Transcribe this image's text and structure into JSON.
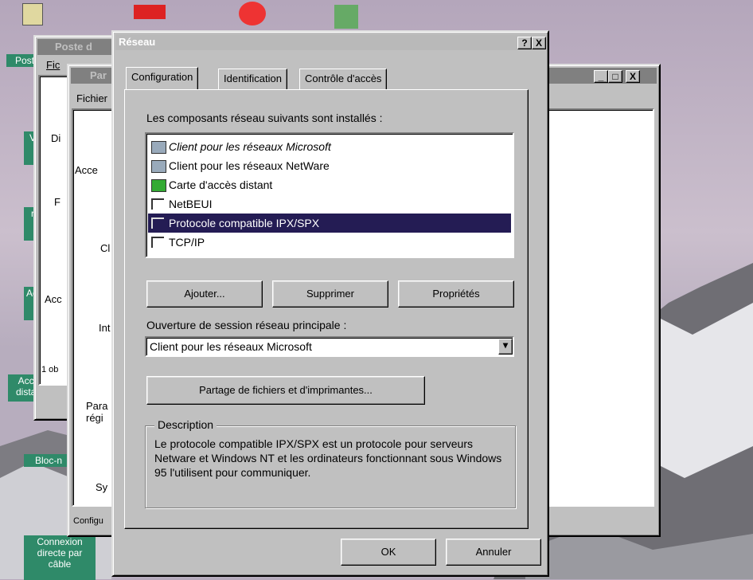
{
  "colors": {
    "desktop_label_bg": "#2f8a69",
    "selected_row": "#241c54",
    "face": "#c0c0c0"
  },
  "desktop": {
    "labels": [
      "Post",
      "V",
      "r",
      "Acc",
      "Acce distan",
      "Bloc-n",
      "Connexion directe par câble"
    ]
  },
  "poste": {
    "title": "Poste d",
    "menu": "Fic",
    "items": [
      "Di",
      "F",
      "Acc"
    ],
    "status": "1 ob"
  },
  "panneau": {
    "title": "Par",
    "menu": "Fichier",
    "items": [
      "Acce",
      "Cl",
      "Int",
      "Para régi",
      "Sy"
    ],
    "status": "Configu",
    "right_fragment": "t"
  },
  "dialog": {
    "title": "Réseau",
    "help_button": "?",
    "close_button": "X",
    "tabs": [
      "Configuration",
      "Identification",
      "Contrôle d'accès"
    ],
    "components_label": "Les composants réseau suivants sont installés :",
    "components": [
      {
        "label": "Client pour les réseaux Microsoft",
        "icon": "client-icon",
        "selected": false,
        "italic": true
      },
      {
        "label": "Client pour les réseaux NetWare",
        "icon": "client-icon",
        "selected": false,
        "italic": false
      },
      {
        "label": "Carte d'accès distant",
        "icon": "adapter-icon",
        "selected": false,
        "italic": false
      },
      {
        "label": "NetBEUI",
        "icon": "protocol-icon",
        "selected": false,
        "italic": false
      },
      {
        "label": "Protocole compatible IPX/SPX",
        "icon": "protocol-icon",
        "selected": true,
        "italic": false
      },
      {
        "label": "TCP/IP",
        "icon": "protocol-icon",
        "selected": false,
        "italic": false
      }
    ],
    "buttons": {
      "add": "Ajouter...",
      "remove": "Supprimer",
      "properties": "Propriétés"
    },
    "logon_label": "Ouverture de session réseau principale :",
    "logon_value": "Client pour les réseaux Microsoft",
    "share_button": "Partage de fichiers et d'imprimantes...",
    "description_title": "Description",
    "description_text": "Le protocole compatible IPX/SPX est un protocole pour serveurs Netware et Windows NT et les ordinateurs fonctionnant sous Windows 95 l'utilisent pour communiquer.",
    "ok": "OK",
    "cancel": "Annuler"
  },
  "back_window_buttons": {
    "min": "_",
    "max": "□",
    "close": "X"
  }
}
